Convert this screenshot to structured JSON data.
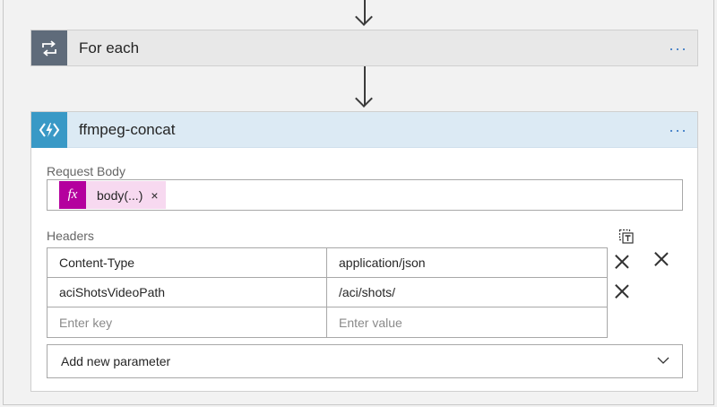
{
  "flow": {
    "foreach": {
      "title": "For each",
      "menu_label": "···",
      "icon": "loop-icon"
    },
    "action": {
      "title": "ffmpeg-concat",
      "menu_label": "···",
      "icon": "azure-function-icon",
      "request_body": {
        "label": "Request Body",
        "token": {
          "fx_label": "fx",
          "text": "body(...)",
          "remove": "×"
        }
      },
      "headers": {
        "label": "Headers",
        "rows": [
          {
            "key": "Content-Type",
            "value": "application/json",
            "key_placeholder": false
          },
          {
            "key": "aciShotsVideoPath",
            "value": "/aci/shots/",
            "key_placeholder": false
          }
        ],
        "empty_row": {
          "key_placeholder": "Enter key",
          "value_placeholder": "Enter value"
        }
      },
      "add_parameter": {
        "label": "Add new parameter"
      }
    }
  },
  "colors": {
    "foreach_icon_bg": "#5f6b7a",
    "function_icon_bg": "#3999c6",
    "header_bg": "#dceaf4",
    "token_fx_bg": "#b4009e",
    "token_bg": "#f7d9f0",
    "accent_dots": "#3a79c4"
  }
}
